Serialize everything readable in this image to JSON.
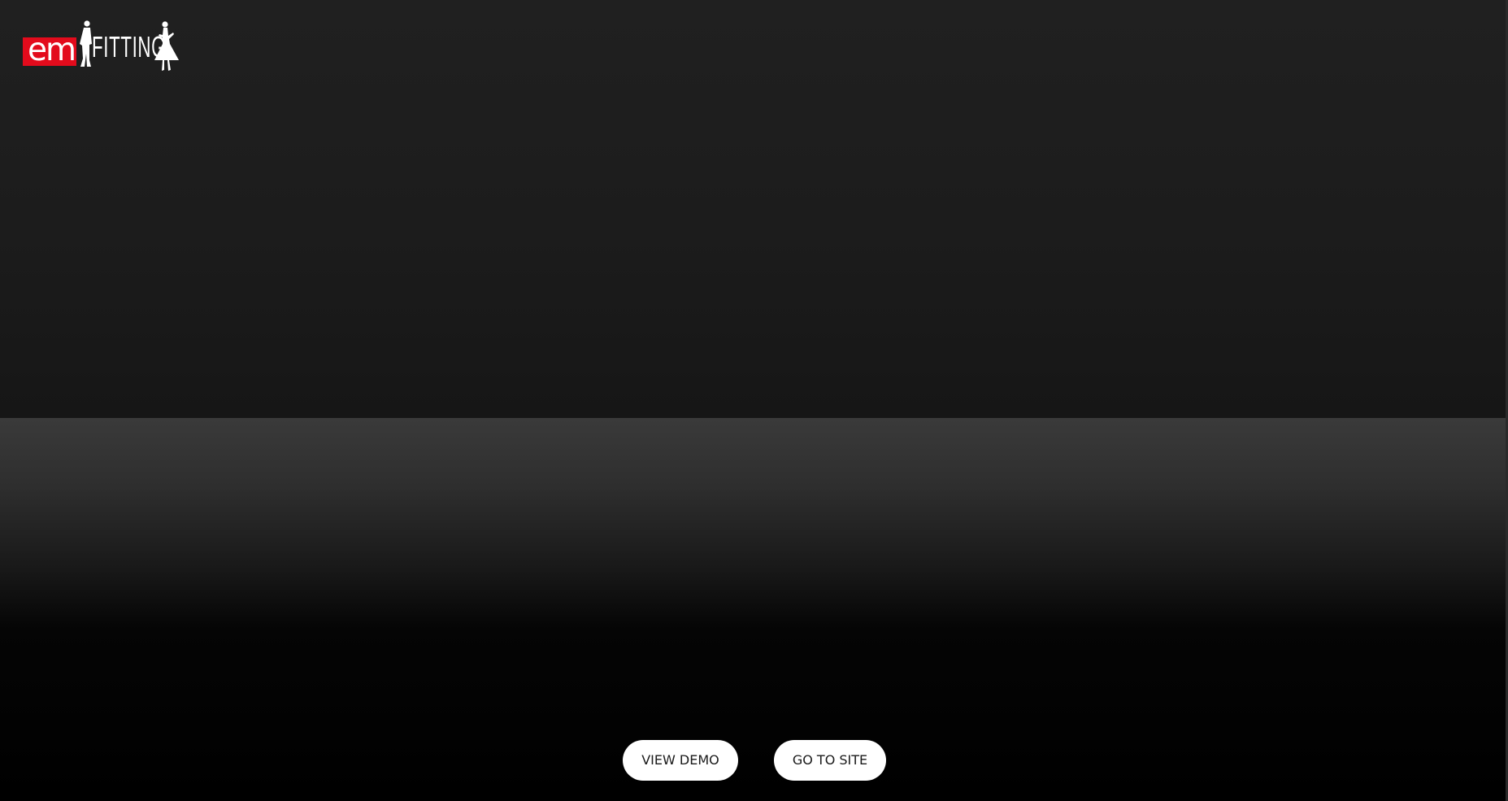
{
  "logo": {
    "em_text": "em",
    "fitting_text": "FITTING",
    "brand_color": "#e30b1c",
    "text_color": "#ffffff"
  },
  "scene": {
    "wall_color": "#1e1e1e",
    "floor_color": "#3a3a3a",
    "background_color": "#000000"
  },
  "actions": {
    "view_demo_label": "VIEW DEMO",
    "go_to_site_label": "GO TO SITE"
  }
}
